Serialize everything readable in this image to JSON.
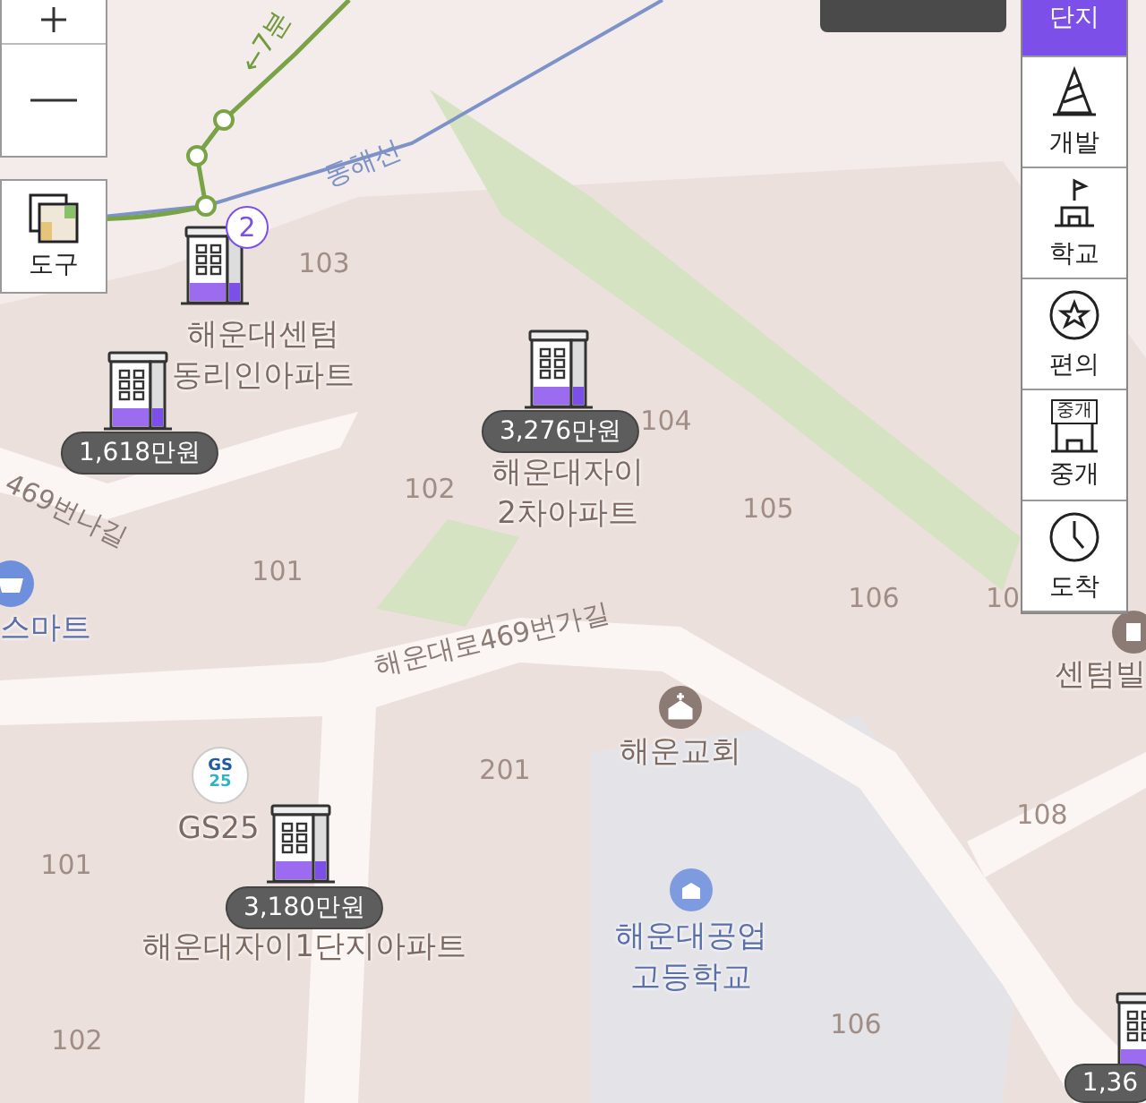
{
  "tool_button": {
    "label": "도구"
  },
  "layer_panel": [
    {
      "kind": "complex",
      "label": "단지",
      "selected": true
    },
    {
      "kind": "development",
      "label": "개발",
      "selected": false
    },
    {
      "kind": "school",
      "label": "학교",
      "selected": false
    },
    {
      "kind": "convenience",
      "label": "편의",
      "selected": false
    },
    {
      "kind": "agent",
      "label": "중개",
      "icon_text": "중개",
      "selected": false
    },
    {
      "kind": "arrival",
      "label": "도착",
      "selected": false
    }
  ],
  "route": {
    "label": "←7분",
    "line_name": "동해선"
  },
  "complexes": [
    {
      "name": "해운대센텀\n동리인아파트",
      "count": "2"
    },
    {
      "price": "1,618만원"
    },
    {
      "price": "3,276만원",
      "name": "해운대자이\n2차아파트"
    },
    {
      "price": "3,180만원",
      "name": "해운대자이1단지아파트"
    },
    {
      "price": "1,36"
    }
  ],
  "places": [
    {
      "kind": "mart",
      "name": "스마트"
    },
    {
      "kind": "store",
      "name": "GS25",
      "logo": [
        "GS",
        "25"
      ]
    },
    {
      "kind": "church",
      "name": "해운교회"
    },
    {
      "kind": "school",
      "name": "해운대공업\n고등학교"
    },
    {
      "kind": "building",
      "name": "센텀빌"
    }
  ],
  "road_labels": [
    "해운대로469번가길",
    "469번나길"
  ],
  "building_numbers": [
    "103",
    "102",
    "104",
    "105",
    "101",
    "106",
    "10",
    "201",
    "108",
    "101",
    "106",
    "102"
  ]
}
